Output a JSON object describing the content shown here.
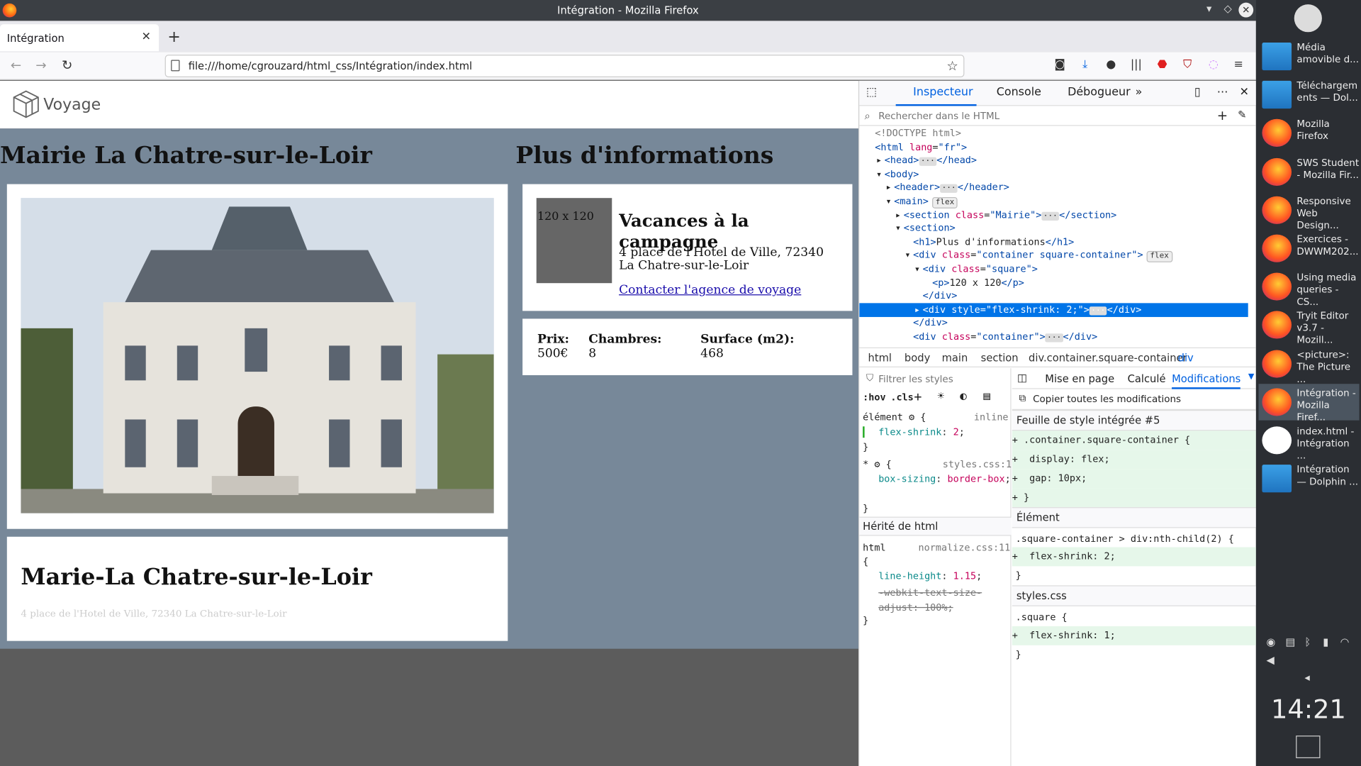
{
  "window": {
    "title": "Intégration - Mozilla Firefox"
  },
  "tab": {
    "label": "Intégration"
  },
  "url": "file:///home/cgrouzard/html_css/Intégration/index.html",
  "site": {
    "brand": "Voyage",
    "h1_left": "Mairie La Chatre-sur-le-Loir",
    "h1_right": "Plus d'informations",
    "card_title": "Marie-La Chatre-sur-le-Loir",
    "card_address": "4 place de l'Hotel de Ville, 72340 La Chatre-sur-le-Loir",
    "square_text": "120 x 120",
    "info_title": "Vacances à la campagne",
    "info_address": "4 place de l'Hotel de Ville, 72340 La Chatre-sur-le-Loir",
    "info_link": "Contacter l'agence de voyage",
    "stats": [
      {
        "label": "Prix:",
        "value": "500€"
      },
      {
        "label": "Chambres:",
        "value": "8"
      },
      {
        "label": "Surface (m2):",
        "value": "468"
      }
    ]
  },
  "devtools": {
    "tabs": [
      "Inspecteur",
      "Console",
      "Débogueur"
    ],
    "search_placeholder": "Rechercher dans le HTML",
    "filter_placeholder": "Filtrer les styles",
    "breadcrumbs": [
      "html",
      "body",
      "main",
      "section",
      "div.container.square-container",
      "div"
    ],
    "markup": [
      {
        "pre": "<!DOCTYPE html>"
      },
      {
        "tag": "<html ",
        "attr": "lang",
        "val": "\"fr\"",
        "post": ">"
      },
      {
        "tag": "<head>",
        "dots": "···",
        "post": "</head>"
      },
      {
        "tag": "<body>"
      },
      {
        "tag": "<header>",
        "dots": "···",
        "post": "</header>"
      },
      {
        "tag": "<main>",
        "badge": "flex"
      },
      {
        "tag": "<section ",
        "attr": "class",
        "val": "\"Mairie\"",
        "post": ">",
        "dots": "···",
        "post2": "</section>"
      },
      {
        "tag": "<section>"
      },
      {
        "tag": "<h1>",
        "text": "Plus d'informations",
        "post": "</h1>"
      },
      {
        "tag": "<div ",
        "attr": "class",
        "val": "\"container square-container\"",
        "post": ">",
        "badge": "flex"
      },
      {
        "tag": "<div ",
        "attr": "class",
        "val": "\"square\"",
        "post": ">"
      },
      {
        "tag": "<p>",
        "text": "120 x 120",
        "post": "</p>"
      },
      {
        "tag": "</div>"
      },
      {
        "tag": "<div ",
        "attr": "style",
        "val": "\"flex-shrink: 2;\"",
        "post": ">",
        "dots": "···",
        "post2": "</div>"
      },
      {
        "tag": "</div>"
      },
      {
        "tag": "<div ",
        "attr": "class",
        "val": "\"container\"",
        "post": ">",
        "dots": "···",
        "post2": "</div>"
      }
    ],
    "rules_toolbar": [
      ":hov",
      ".cls"
    ],
    "element_label": "élément",
    "inline": "inline",
    "flex_shrink": "flex-shrink",
    "flex_shrink_val": "2",
    "star_src": "styles.css:1",
    "box_sizing": "box-sizing",
    "box_sizing_val": "border-box",
    "inherited": "Hérité de html",
    "html_sel": "html",
    "normalize_src": "normalize.css:11",
    "line_height": "line-height",
    "line_height_val": "1.15",
    "webkit": "-webkit-text-size-adjust: 100%;",
    "side_tabs": [
      "Mise en page",
      "Calculé",
      "Modifications"
    ],
    "copy_all": "Copier toutes les modifications",
    "sheet": "Feuille de style intégrée #5",
    "rule1_sel": ".container.square-container {",
    "rule1": [
      "display: flex;",
      "gap: 10px;"
    ],
    "elem_head": "Élément",
    "rule2_sel": ".square-container > div:nth-child(2) {",
    "rule2": "flex-shrink: 2;",
    "styles_head": "styles.css",
    "rule3_sel": ".square {",
    "rule3": "flex-shrink: 1;"
  },
  "panel": {
    "tasks": [
      {
        "icon": "folder",
        "text": "Média amovible d..."
      },
      {
        "icon": "folder",
        "text": "Téléchargem ents — Dol..."
      },
      {
        "icon": "fox",
        "text": "Mozilla Firefox"
      },
      {
        "icon": "fox",
        "text": "SWS Student - Mozilla Fir..."
      },
      {
        "icon": "fox",
        "text": "Responsive Web Design..."
      },
      {
        "icon": "fox",
        "text": "Exercices - DWWM202..."
      },
      {
        "icon": "fox",
        "text": "Using media queries - CS..."
      },
      {
        "icon": "fox",
        "text": "Tryit Editor v3.7 - Mozill..."
      },
      {
        "icon": "fox",
        "text": "<picture>: The Picture ..."
      },
      {
        "icon": "fox",
        "text": "Intégration - Mozilla Firef...",
        "active": true
      },
      {
        "icon": "vscode",
        "text": "index.html - Intégration ..."
      },
      {
        "icon": "folder",
        "text": "Intégration — Dolphin ..."
      }
    ],
    "clock": "14:21"
  }
}
